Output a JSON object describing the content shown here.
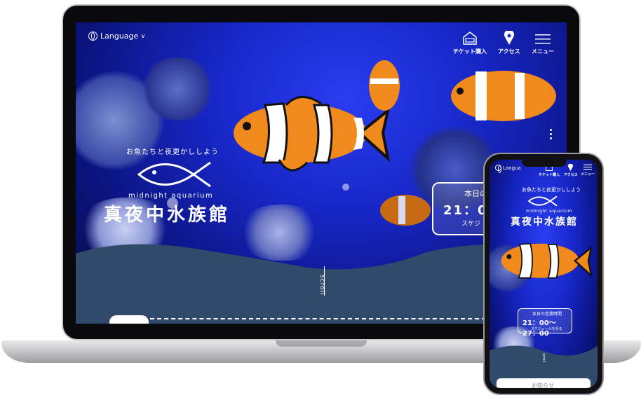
{
  "desktop": {
    "language_label": "Language",
    "nav": [
      {
        "label": "チケット購入",
        "icon": "ticket-house-icon"
      },
      {
        "label": "アクセス",
        "icon": "map-pin-icon"
      },
      {
        "label": "メニュー",
        "icon": "hamburger-menu-icon"
      }
    ],
    "tagline": "お魚たちと夜更かししよう",
    "logo_en": "midnight aquarium",
    "logo_jp": "真夜中水族館",
    "hours": {
      "label": "本日の",
      "time": "21：00",
      "note": "スケジ"
    },
    "scroll_label": "scroll"
  },
  "mobile": {
    "language_label": "Langua",
    "nav": [
      {
        "label": "チケット購入",
        "icon": "ticket-house-icon"
      },
      {
        "label": "アクセス",
        "icon": "map-pin-icon"
      },
      {
        "label": "メニュー",
        "icon": "hamburger-menu-icon"
      }
    ],
    "tagline": "お魚たちと夜更かししよう",
    "logo_en": "midnight aquarium",
    "logo_jp": "真夜中水族館",
    "hours": {
      "label": "本日の営業時間",
      "time": "21：00〜27：00",
      "note": "スケジュールを見る"
    },
    "scroll_label": "scroll",
    "card_label": "お知らせ"
  },
  "colors": {
    "ocean": "#1727c7",
    "wave": "#2f4a6b",
    "clownfish": "#f08a1c"
  }
}
